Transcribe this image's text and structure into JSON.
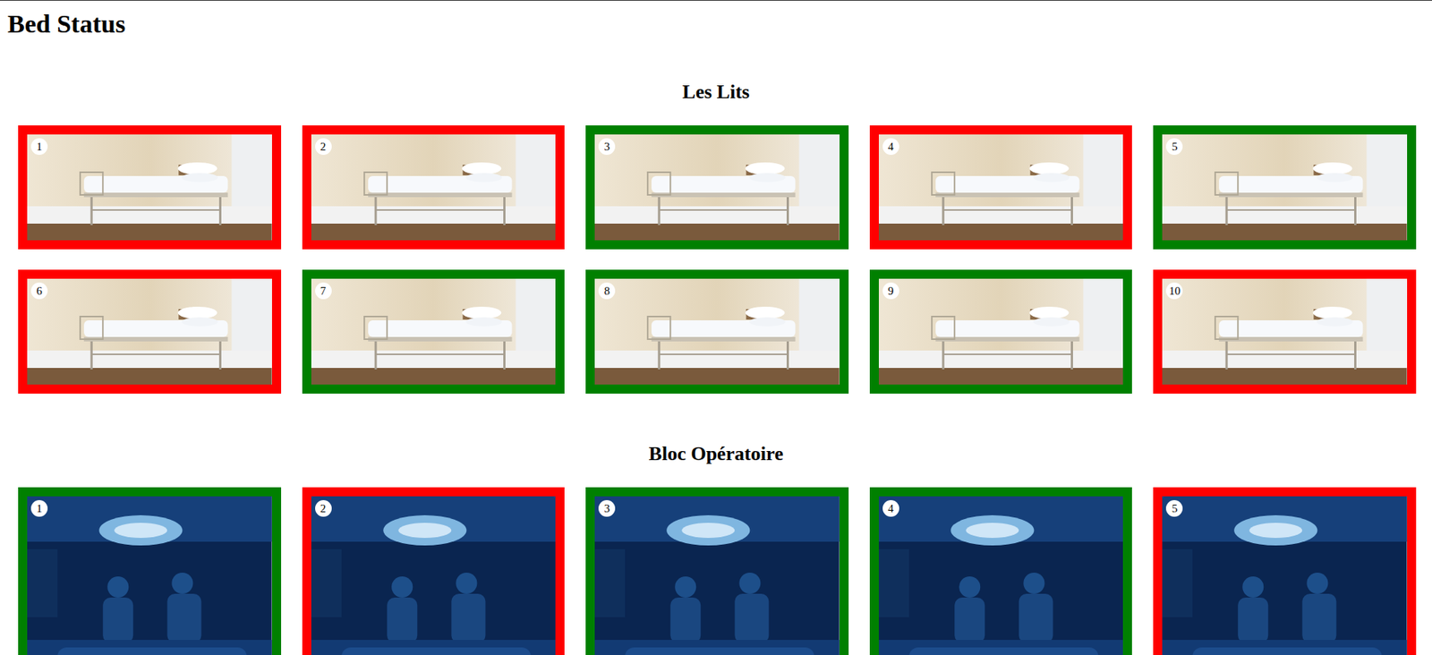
{
  "page": {
    "title": "Bed Status"
  },
  "sections": [
    {
      "title": "Les Lits",
      "kind": "bed",
      "items": [
        {
          "number": "1",
          "color": "#ff0000"
        },
        {
          "number": "2",
          "color": "#ff0000"
        },
        {
          "number": "3",
          "color": "#008000"
        },
        {
          "number": "4",
          "color": "#ff0000"
        },
        {
          "number": "5",
          "color": "#008000"
        },
        {
          "number": "6",
          "color": "#ff0000"
        },
        {
          "number": "7",
          "color": "#008000"
        },
        {
          "number": "8",
          "color": "#008000"
        },
        {
          "number": "9",
          "color": "#008000"
        },
        {
          "number": "10",
          "color": "#ff0000"
        }
      ]
    },
    {
      "title": "Bloc Opératoire",
      "kind": "operating",
      "items": [
        {
          "number": "1",
          "color": "#008000"
        },
        {
          "number": "2",
          "color": "#ff0000"
        },
        {
          "number": "3",
          "color": "#008000"
        },
        {
          "number": "4",
          "color": "#008000"
        },
        {
          "number": "5",
          "color": "#ff0000"
        }
      ]
    }
  ]
}
